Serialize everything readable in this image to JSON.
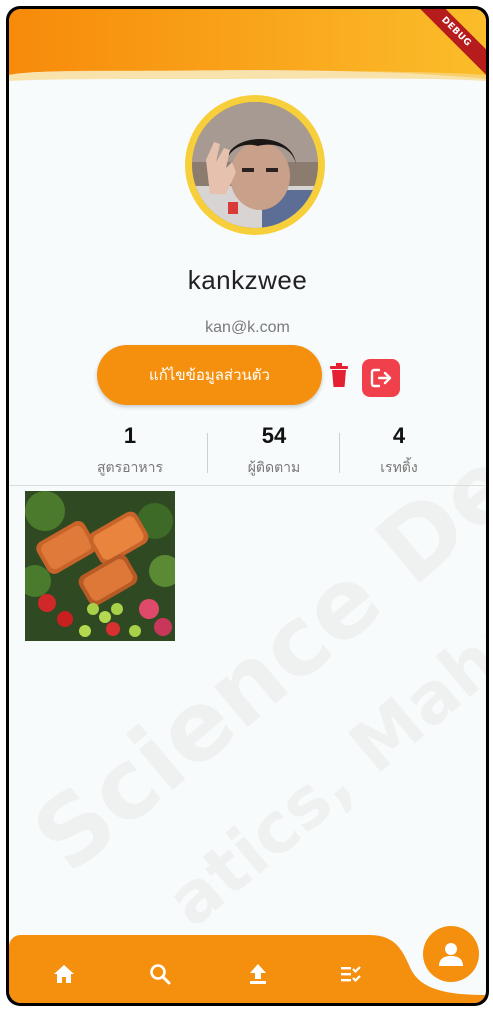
{
  "debug_banner": "DEBUG",
  "profile": {
    "username": "kankzwee",
    "email": "kan@k.com",
    "edit_label": "แก้ไขข้อมูลส่วนตัว"
  },
  "stats": [
    {
      "value": "1",
      "label": "สูตรอาหาร"
    },
    {
      "value": "54",
      "label": "ผู้ติดตาม"
    },
    {
      "value": "4",
      "label": "เรทติ้ง"
    }
  ],
  "nav": {
    "items": [
      {
        "icon": "home-icon"
      },
      {
        "icon": "search-icon"
      },
      {
        "icon": "upload-icon"
      },
      {
        "icon": "checklist-icon"
      },
      {
        "icon": "profile-icon",
        "active": true
      }
    ]
  },
  "colors": {
    "accent": "#f5900e",
    "avatar_ring": "#f7cf3a",
    "logout": "#f0404c",
    "delete": "#e52030"
  }
}
